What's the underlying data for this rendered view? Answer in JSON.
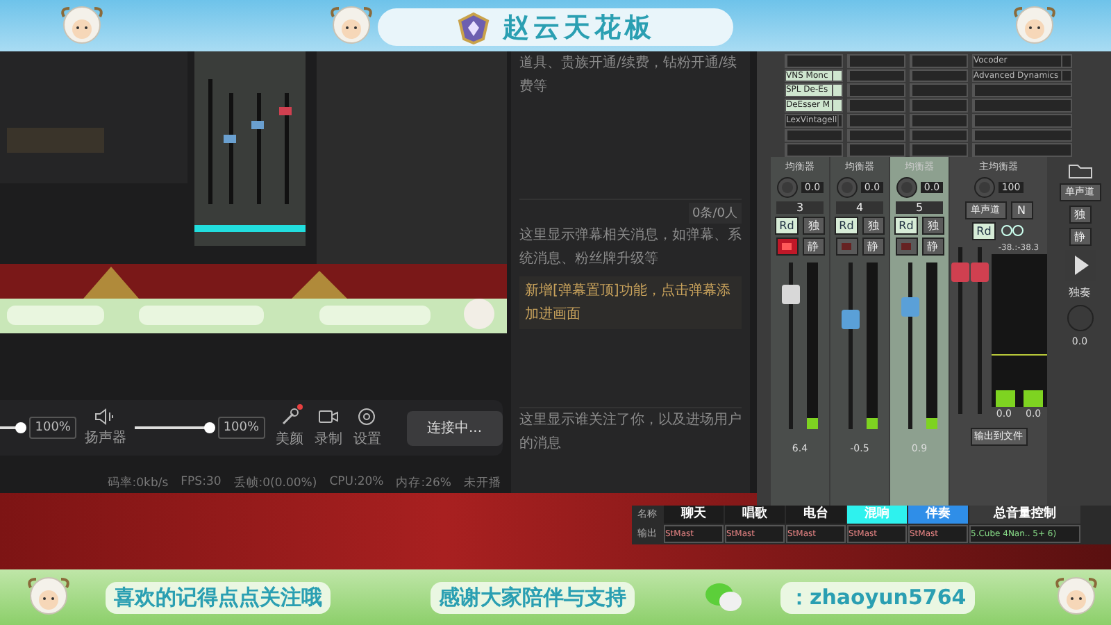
{
  "top_banner": {
    "title": "赵云天花板"
  },
  "controls": {
    "mic_slider": {
      "level": 1
    },
    "mic_reading": "100%",
    "speaker_label": "扬声器",
    "speaker_slider": {
      "level": 1
    },
    "speaker_reading": "100%",
    "tools": [
      {
        "label": "美颜",
        "kind": "beauty",
        "badge": true
      },
      {
        "label": "录制",
        "kind": "record",
        "badge": false
      },
      {
        "label": "设置",
        "kind": "settings",
        "badge": false
      }
    ],
    "connect_button": "连接中..."
  },
  "status_bar": [
    "码率:0kb/s",
    "FPS:30",
    "丢帧:0(0.00%)",
    "CPU:20%",
    "内存:26%",
    "未开播"
  ],
  "chat_panel": {
    "gift_text": "道具、贵族开通/续费，钻粉开通/续费等",
    "count": "0条/0人",
    "danmaku_text": "这里显示弹幕相关消息，如弹幕、系统消息、粉丝牌升级等",
    "notice": "新增[弹幕置顶]功能，点击弹幕添加进画面",
    "follow_text": "这里显示谁关注了你，以及进场用户的消息"
  },
  "mixer": {
    "inserts": [
      [
        "VNS Monc",
        "SPL De-Es",
        "DeEsser M",
        "LexVintagell"
      ],
      [
        "Vocoder",
        "Advanced Dynamics"
      ]
    ],
    "strips": [
      {
        "header": "均衡器",
        "knob_value": "0.0",
        "number": "3",
        "rec": "Rd",
        "solo": "独",
        "mute": "静",
        "armed": true,
        "selected": false,
        "level": 0.85,
        "color": "#d8d8d8",
        "reading": "6.4"
      },
      {
        "header": "均衡器",
        "knob_value": "0.0",
        "number": "4",
        "rec": "Rd",
        "solo": "独",
        "mute": "静",
        "armed": false,
        "selected": false,
        "level": 0.68,
        "color": "#5aa0d8",
        "reading": "-0.5"
      },
      {
        "header": "均衡器",
        "knob_value": "0.0",
        "number": "5",
        "rec": "Rd",
        "solo": "独",
        "mute": "静",
        "armed": false,
        "selected": true,
        "level": 0.76,
        "color": "#5aa0d8",
        "reading": "0.9"
      }
    ],
    "master": {
      "header": "主均衡器",
      "knob_value": "100",
      "mode": "单声道",
      "mode_key": "N",
      "rec": "Rd",
      "meter_reading": "-38.:-38.3",
      "level": 0.9,
      "readings": [
        "0.0",
        "0.0"
      ],
      "output_button": "输出到文件"
    },
    "side": {
      "mode": "单声道",
      "solo": "独",
      "mute": "静",
      "solo_label": "独奏",
      "value": "0.0"
    },
    "name_label": "名称",
    "output_label": "输出",
    "tracks": [
      {
        "name": "聊天",
        "color": "#1c1c1c",
        "output": "StMast"
      },
      {
        "name": "唱歌",
        "color": "#1c1c1c",
        "output": "StMast"
      },
      {
        "name": "电台",
        "color": "#1c1c1c",
        "output": "StMast"
      },
      {
        "name": "混响",
        "color": "#2ef2ee",
        "output": "StMast"
      },
      {
        "name": "伴奏",
        "color": "#2f8ee8",
        "output": "StMast"
      },
      {
        "name": "总音量控制",
        "color": "#3a3a3a",
        "output": "5.Cube 4Nan.. 5+ 6)"
      }
    ]
  },
  "bottom_banner": {
    "texts": [
      "喜欢的记得点点关注哦",
      "感谢大家陪伴与支持"
    ],
    "contact": "：zhaoyun5764"
  }
}
